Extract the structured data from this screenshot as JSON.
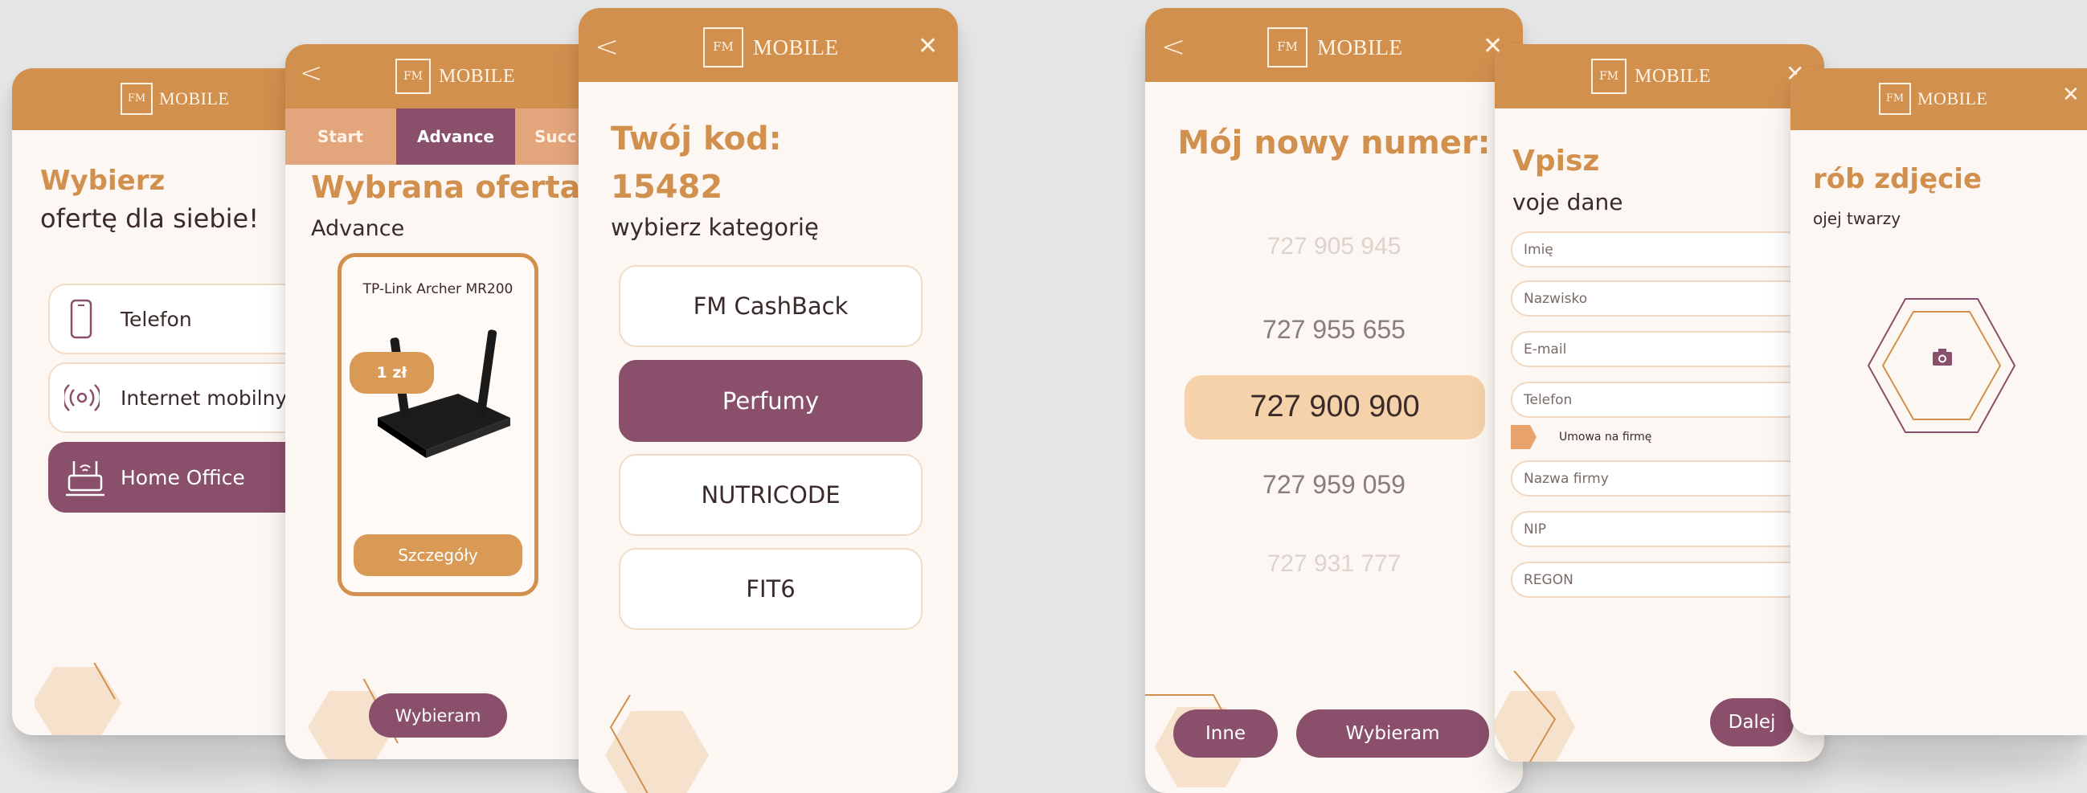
{
  "brand": {
    "logo_letters": "FM",
    "name": "MOBILE"
  },
  "colors": {
    "accent": "#d2904e",
    "plum": "#8a4f6b",
    "cream": "#fcf7f2",
    "peach": "#f5d2aa"
  },
  "screen1": {
    "heading": "Wybierz",
    "subheading": "ofertę dla siebie!",
    "options": [
      {
        "label": "Telefon",
        "icon": "phone-icon"
      },
      {
        "label": "Internet mobilny",
        "icon": "broadcast-icon"
      },
      {
        "label": "Home Office",
        "icon": "router-icon"
      }
    ]
  },
  "screen2": {
    "back": "<",
    "tabs": [
      "Start",
      "Advance",
      "Succ"
    ],
    "heading": "Wybrana oferta:",
    "offer": "Advance",
    "product": "TP-Link Archer MR200",
    "price": "1 zł",
    "details_button": "Szczegóły",
    "choose_button": "Wybieram"
  },
  "screen3": {
    "back": "<",
    "close": "✕",
    "heading": "Twój kod:",
    "code": "15482",
    "subheading": "wybierz kategorię",
    "categories": [
      "FM CashBack",
      "Perfumy",
      "NUTRICODE",
      "FIT6"
    ]
  },
  "screen4": {
    "back": "<",
    "close": "✕",
    "heading": "Mój nowy numer:",
    "numbers": [
      "727 905 945",
      "727 955 655",
      "727 900 900",
      "727 959 059",
      "727 931 777"
    ],
    "other_button": "Inne",
    "choose_button": "Wybieram"
  },
  "screen5": {
    "close": "✕",
    "heading": "Vpisz",
    "subheading": "voje dane",
    "fields": [
      "Imię",
      "Nazwisko",
      "E-mail",
      "Telefon"
    ],
    "toggle_label": "Umowa na firmę",
    "company_fields": [
      "Nazwa firmy",
      "NIP",
      "REGON"
    ],
    "next_button": "Dalej"
  },
  "screen6": {
    "close": "✕",
    "heading": "rób zdjęcie",
    "subheading": "ojej twarzy",
    "camera_icon": "camera-icon"
  }
}
